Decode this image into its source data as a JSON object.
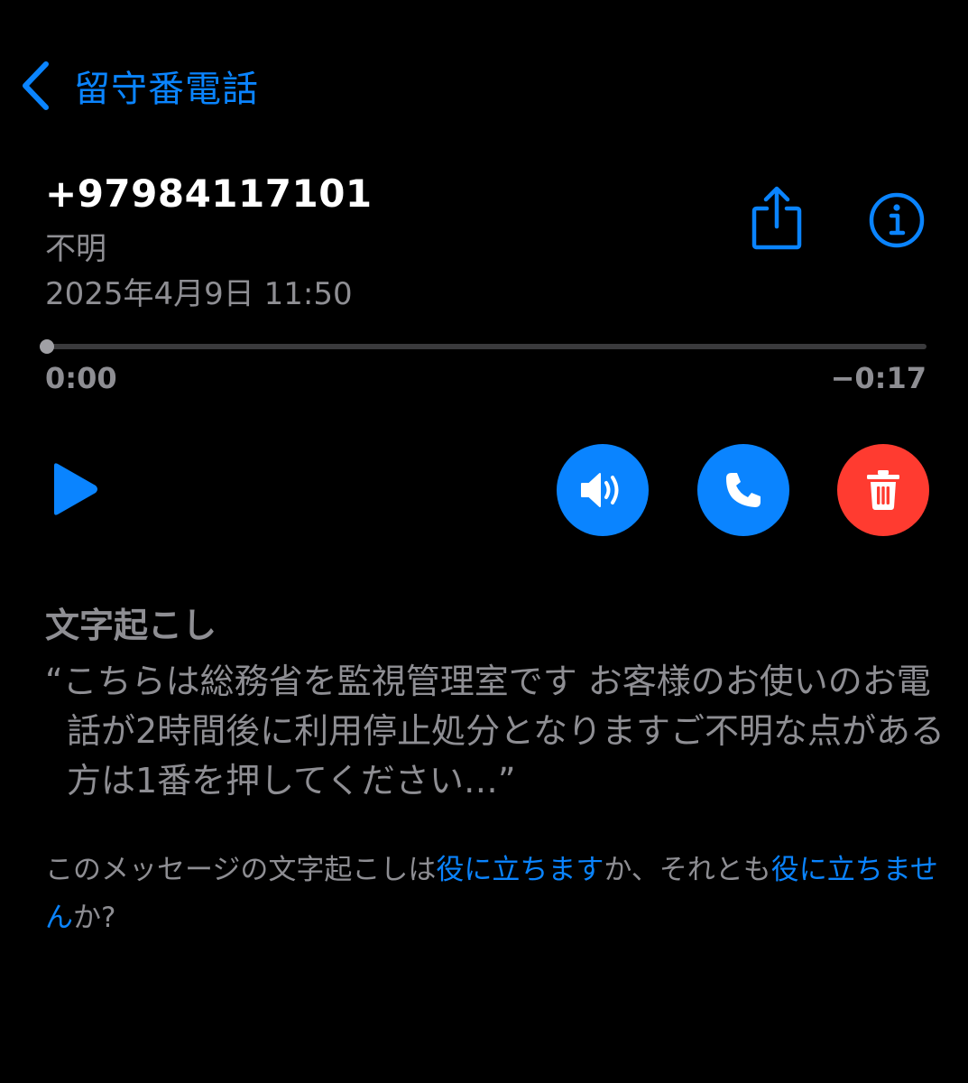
{
  "nav": {
    "back_label": "留守番電話"
  },
  "voicemail": {
    "number": "+97984117101",
    "label": "不明",
    "date": "2025年4月9日 11:50"
  },
  "playback": {
    "elapsed": "0:00",
    "remaining": "−0:17",
    "progress": 0
  },
  "transcript": {
    "heading": "文字起こし",
    "text": "“こちらは総務省を監視管理室です お客様のお使いのお電話が2時間後に利用停止処分となりますご不明な点がある方は1番を押してください…”"
  },
  "feedback": {
    "prefix": "このメッセージの文字起こしは",
    "useful_link": "役に立ちます",
    "middle": "か、それとも",
    "not_useful_link": "役に立ちません",
    "suffix": "か?"
  },
  "icons": {
    "back": "chevron-left-icon",
    "share": "share-icon",
    "info": "info-icon",
    "play": "play-icon",
    "speaker": "speaker-icon",
    "call": "phone-icon",
    "delete": "trash-icon"
  },
  "colors": {
    "background": "#000000",
    "accent": "#0a84ff",
    "secondary_text": "#8e8e93",
    "delete": "#ff3b30"
  }
}
